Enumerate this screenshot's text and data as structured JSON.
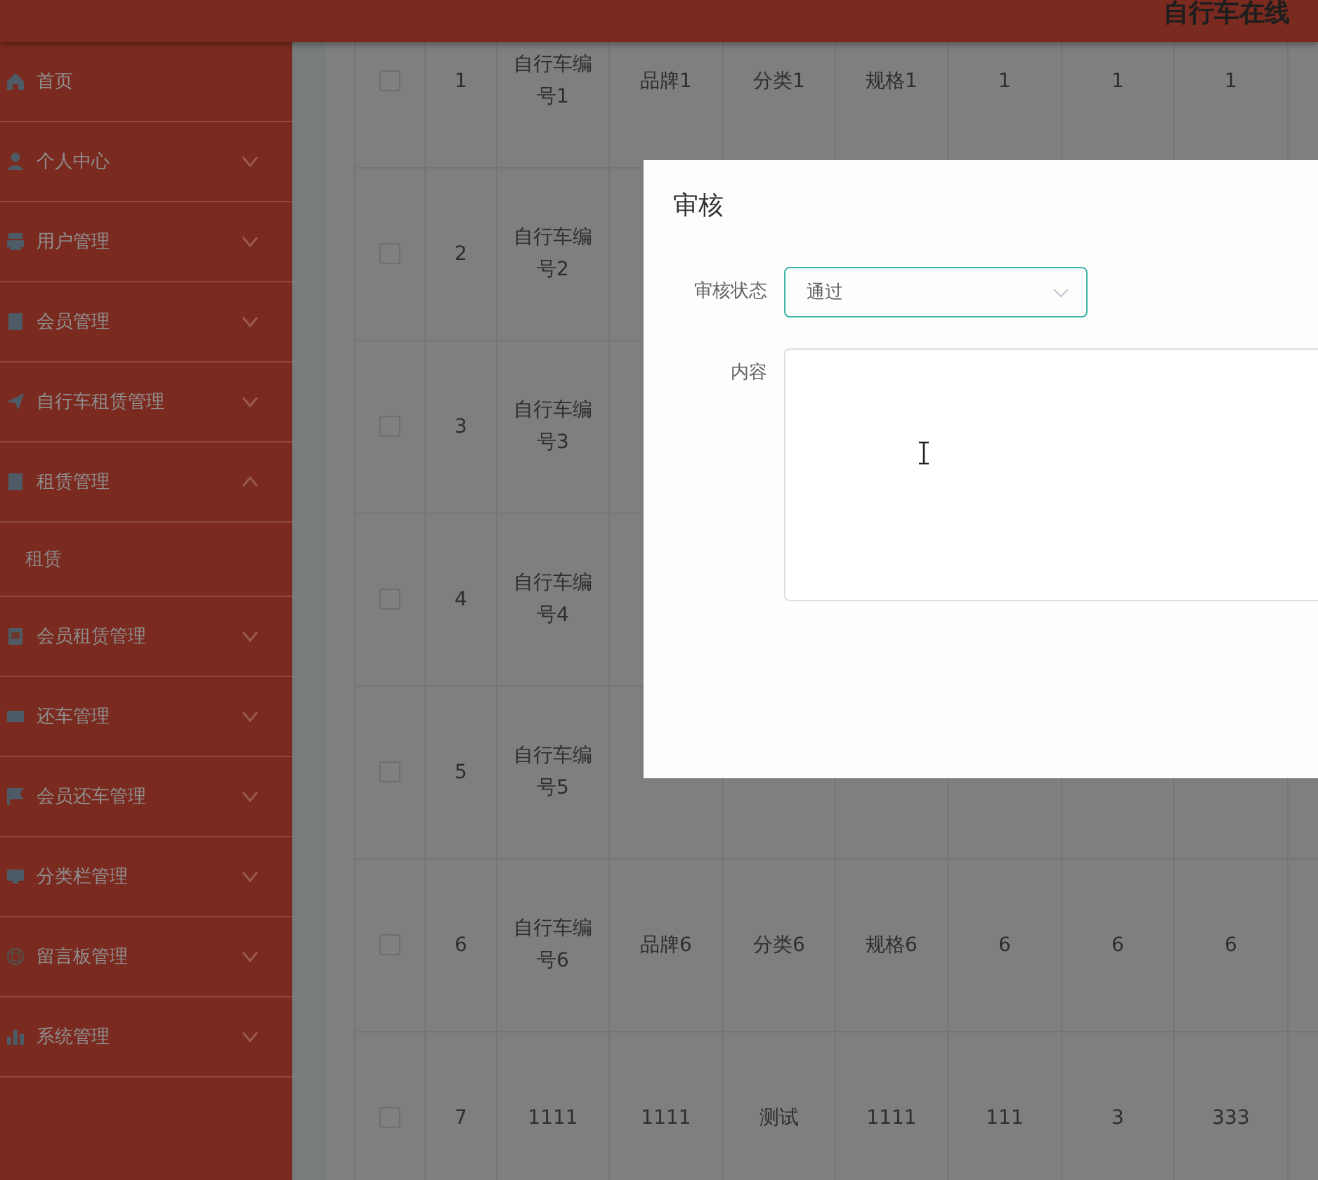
{
  "header": {
    "title": "自行车在线"
  },
  "sidebar": {
    "items": [
      {
        "label": "首页"
      },
      {
        "label": "个人中心",
        "expanded": false
      },
      {
        "label": "用户管理",
        "expanded": false
      },
      {
        "label": "会员管理",
        "expanded": false
      },
      {
        "label": "自行车租赁管理",
        "expanded": false
      },
      {
        "label": "租赁管理",
        "expanded": true,
        "children": [
          {
            "label": "租赁"
          }
        ]
      },
      {
        "label": "会员租赁管理",
        "expanded": false
      },
      {
        "label": "还车管理",
        "expanded": false
      },
      {
        "label": "会员还车管理",
        "expanded": false
      },
      {
        "label": "分类栏管理",
        "expanded": false
      },
      {
        "label": "留言板管理",
        "expanded": false
      },
      {
        "label": "系统管理",
        "expanded": false
      }
    ]
  },
  "table": {
    "rows": [
      {
        "checked": false,
        "cells": [
          "1",
          "自行车编号1",
          "品牌1",
          "分类1",
          "规格1",
          "1",
          "1",
          "1"
        ]
      },
      {
        "checked": false,
        "cells": [
          "2",
          "自行车编号2"
        ]
      },
      {
        "checked": false,
        "cells": [
          "3",
          "自行车编号3"
        ]
      },
      {
        "checked": false,
        "cells": [
          "4",
          "自行车编号4"
        ]
      },
      {
        "checked": false,
        "cells": [
          "5",
          "自行车编号5"
        ]
      },
      {
        "checked": false,
        "cells": [
          "6",
          "自行车编号6",
          "品牌6",
          "分类6",
          "规格6",
          "6",
          "6",
          "6"
        ]
      },
      {
        "checked": false,
        "cells": [
          "7",
          "1111",
          "1111",
          "测试",
          "1111",
          "111",
          "3",
          "333"
        ]
      }
    ]
  },
  "dialog": {
    "title": "审核",
    "status_label": "审核状态",
    "status_value": "通过",
    "content_label": "内容"
  }
}
